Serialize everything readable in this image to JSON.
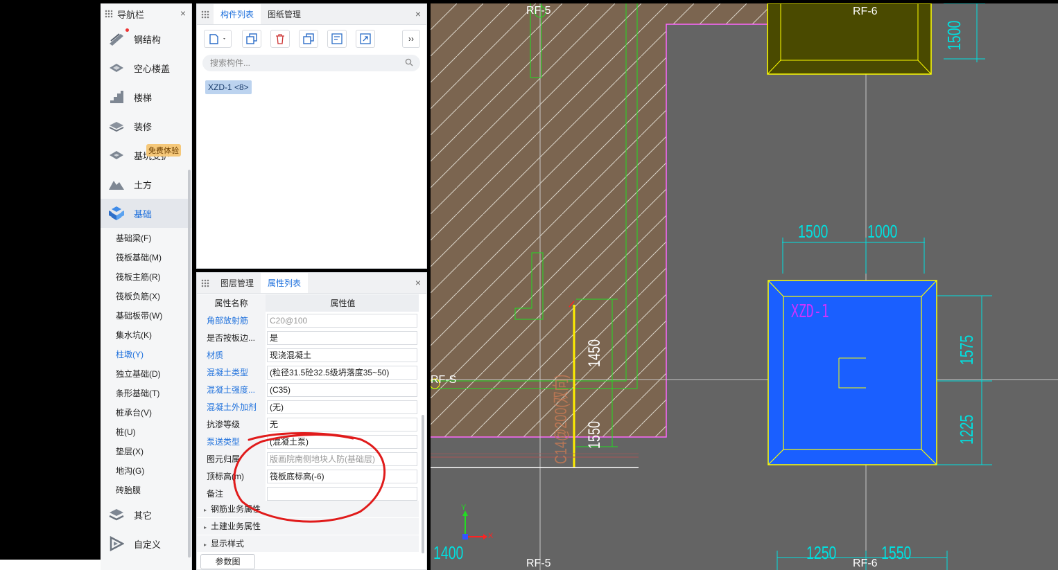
{
  "nav": {
    "title": "导航栏",
    "close": "×",
    "categories": [
      {
        "label": "钢结构"
      },
      {
        "label": "空心楼盖"
      },
      {
        "label": "楼梯"
      },
      {
        "label": "装修"
      },
      {
        "label": "基坑支护"
      },
      {
        "label": "土方"
      },
      {
        "label": "基础"
      }
    ],
    "trial_badge": "免费体验",
    "sub_items": [
      "基础梁(F)",
      "筏板基础(M)",
      "筏板主筋(R)",
      "筏板负筋(X)",
      "基础板带(W)",
      "集水坑(K)",
      "柱墩(Y)",
      "独立基础(D)",
      "条形基础(T)",
      "桩承台(V)",
      "桩(U)",
      "垫层(X)",
      "地沟(G)",
      "砖胎膜"
    ],
    "bottom_categories": [
      {
        "label": "其它"
      },
      {
        "label": "自定义"
      }
    ]
  },
  "component_panel": {
    "tabs": [
      "构件列表",
      "图纸管理"
    ],
    "search_placeholder": "搜索构件...",
    "item": "XZD-1 <8>",
    "more": "››"
  },
  "property_panel": {
    "tabs": [
      "图层管理",
      "属性列表"
    ],
    "header_name": "属性名称",
    "header_value": "属性值",
    "rows": [
      {
        "name": "角部放射筋",
        "value": "C20@100"
      },
      {
        "name": "是否按板边...",
        "value": "是"
      },
      {
        "name": "材质",
        "value": "现浇混凝土"
      },
      {
        "name": "混凝土类型",
        "value": "(粒径31.5砼32.5级坍落度35~50)"
      },
      {
        "name": "混凝土强度...",
        "value": "(C35)"
      },
      {
        "name": "混凝土外加剂",
        "value": "(无)"
      },
      {
        "name": "抗渗等级",
        "value": "无"
      },
      {
        "name": "泵送类型",
        "value": "(混凝土泵)"
      },
      {
        "name": "图元归属",
        "value": "版画院南侧地块人防(基础层)"
      },
      {
        "name": "顶标高(m)",
        "value": "筏板底标高(-6)"
      },
      {
        "name": "备注",
        "value": ""
      }
    ],
    "groups": [
      "钢筋业务属性",
      "土建业务属性",
      "显示样式"
    ],
    "button": "参数图"
  },
  "cad": {
    "labels": {
      "rf5_top": "RF-5",
      "rf6_top": "RF-6",
      "rf5_bottom": "RF-5",
      "rf6_bottom": "RF-6",
      "rfs": "RF-S",
      "xzd": "XZD-1",
      "d1500_top": "1500",
      "d1500": "1500",
      "d1000": "1000",
      "d1575": "1575",
      "d1225": "1225",
      "d1450": "1450",
      "d1550": "1550",
      "d1400": "1400",
      "d1250": "1250",
      "d1550b": "1550",
      "rebar_text": "C14@200(双向)",
      "axis_x": "X",
      "axis_y": "Y"
    }
  }
}
